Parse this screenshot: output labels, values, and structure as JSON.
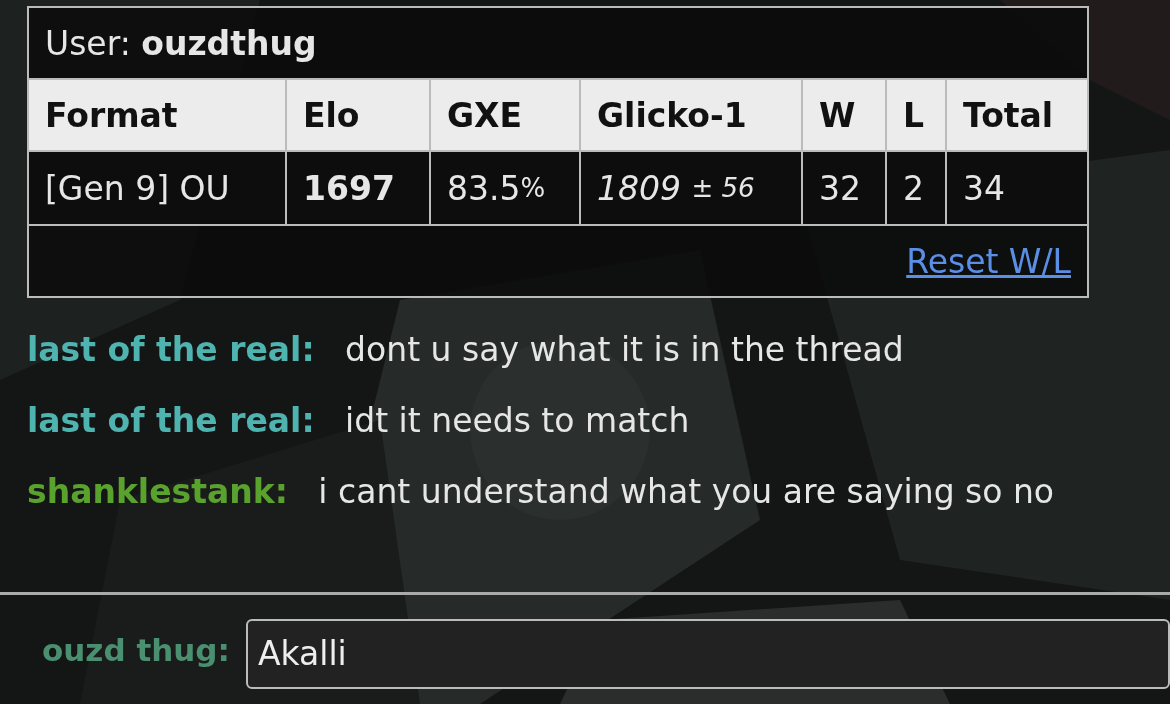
{
  "user_card": {
    "label": "User:",
    "username": "ouzdthug",
    "columns": [
      "Format",
      "Elo",
      "GXE",
      "Glicko-1",
      "W",
      "L",
      "Total"
    ],
    "row": {
      "format": "[Gen 9] OU",
      "elo": "1697",
      "gxe": "83.5",
      "gxe_unit": "%",
      "glicko": "1809",
      "glicko_deviation": "± 56",
      "wins": "32",
      "losses": "2",
      "total": "34"
    },
    "reset_link": "Reset W/L"
  },
  "messages": [
    {
      "user": "last of the real:",
      "color": "#4fb3b0",
      "text": "dont u say what it is in the thread"
    },
    {
      "user": "last of the real:",
      "color": "#4fb3b0",
      "text": "idt it needs to match"
    },
    {
      "user": "shanklestank:",
      "color": "#5aa22e",
      "text": "i cant understand what you are saying so no"
    }
  ],
  "composer": {
    "user": "ouzd thug:",
    "color": "#4a9070",
    "value": "Akalli"
  }
}
